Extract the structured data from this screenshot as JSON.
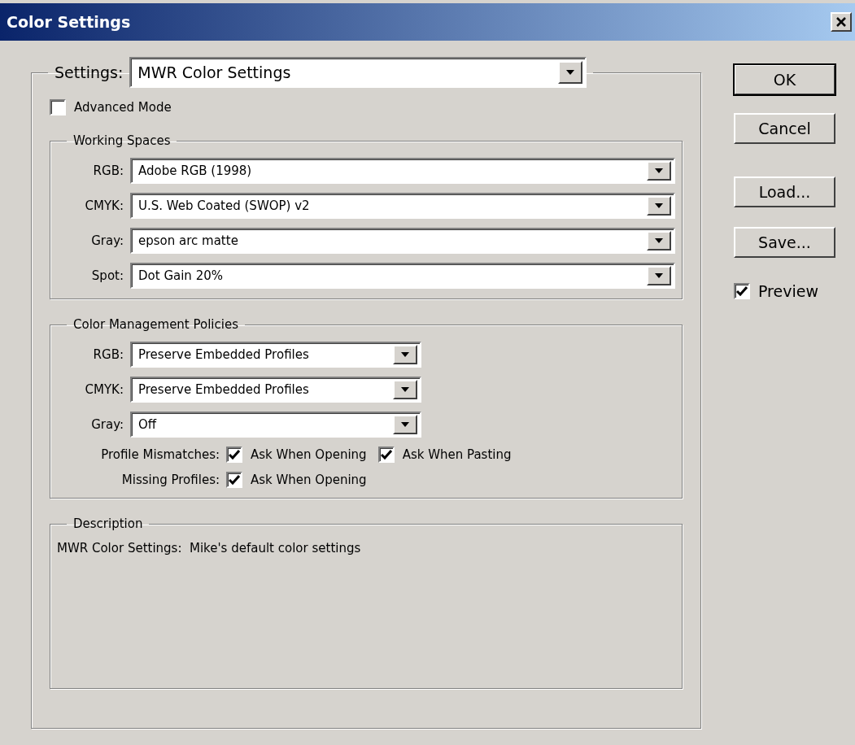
{
  "window": {
    "title": "Color Settings"
  },
  "settings": {
    "label": "Settings:",
    "value": "MWR Color Settings"
  },
  "advanced_mode": {
    "label": "Advanced Mode",
    "checked": false
  },
  "working_spaces": {
    "title": "Working Spaces",
    "rows": [
      {
        "label": "RGB:",
        "value": "Adobe RGB (1998)"
      },
      {
        "label": "CMYK:",
        "value": "U.S. Web Coated (SWOP) v2"
      },
      {
        "label": "Gray:",
        "value": "epson arc matte"
      },
      {
        "label": "Spot:",
        "value": "Dot Gain 20%"
      }
    ]
  },
  "policies": {
    "title": "Color Management Policies",
    "rows": [
      {
        "label": "RGB:",
        "value": "Preserve Embedded Profiles"
      },
      {
        "label": "CMYK:",
        "value": "Preserve Embedded Profiles"
      },
      {
        "label": "Gray:",
        "value": "Off"
      }
    ],
    "checkbox_rows": [
      {
        "label": "Profile Mismatches:",
        "options": [
          {
            "label": "Ask When Opening",
            "checked": true
          },
          {
            "label": "Ask When Pasting",
            "checked": true
          }
        ]
      },
      {
        "label": "Missing Profiles:",
        "options": [
          {
            "label": "Ask When Opening",
            "checked": true
          }
        ]
      }
    ]
  },
  "description": {
    "title": "Description",
    "text": "MWR Color Settings:  Mike's default color settings"
  },
  "buttons": [
    {
      "label": "OK",
      "default": true
    },
    {
      "label": "Cancel",
      "default": false
    }
  ],
  "file_buttons": [
    {
      "label": "Load...",
      "default": false
    },
    {
      "label": "Save...",
      "default": false
    }
  ],
  "preview": {
    "label": "Preview",
    "checked": true
  }
}
